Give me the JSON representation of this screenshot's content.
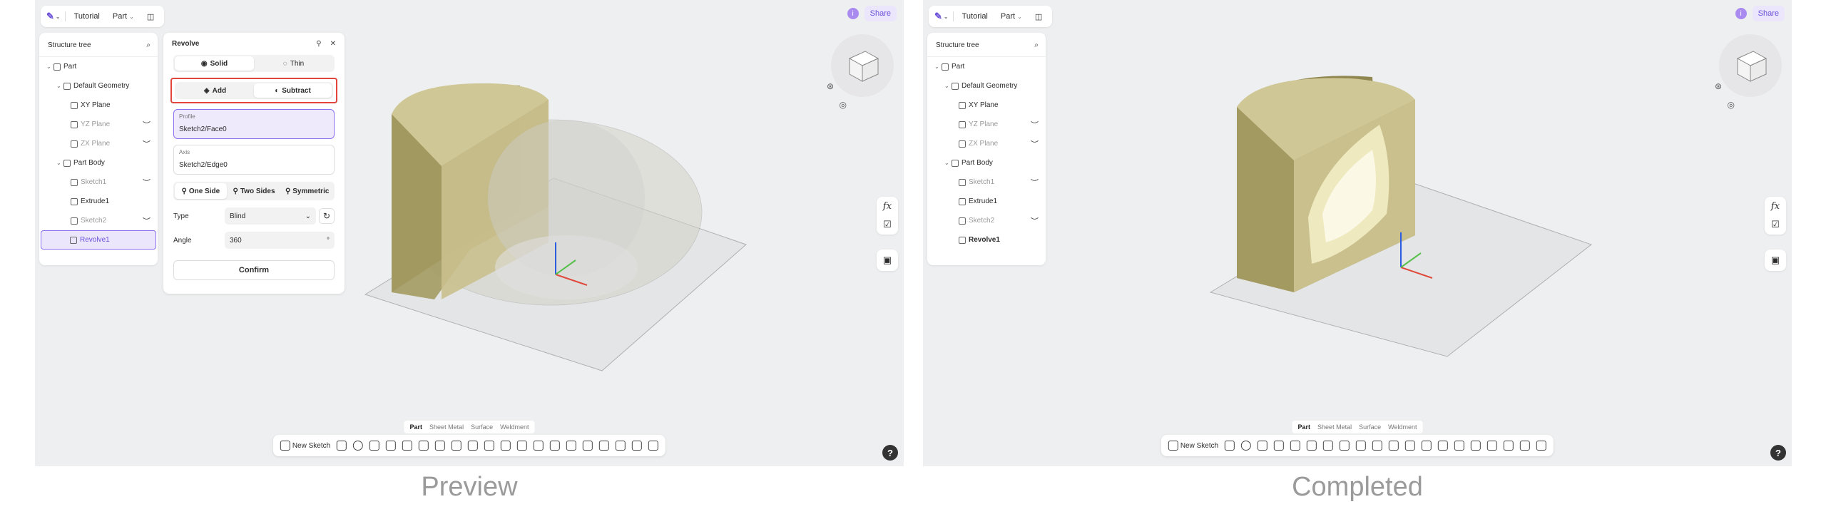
{
  "topbar": {
    "project": "Tutorial",
    "mode": "Part",
    "share": "Share",
    "avatar": "i"
  },
  "tree": {
    "title": "Structure tree",
    "items": [
      "Part",
      "Default Geometry",
      "XY Plane",
      "YZ Plane",
      "ZX Plane",
      "Part Body",
      "Sketch1",
      "Extrude1",
      "Sketch2",
      "Revolve1"
    ]
  },
  "revolve": {
    "title": "Revolve",
    "type_opts": [
      "Solid",
      "Thin"
    ],
    "bool_opts": [
      "Add",
      "Subtract"
    ],
    "profile_label": "Profile",
    "profile_value": "Sketch2/Face0",
    "axis_label": "Axis",
    "axis_value": "Sketch2/Edge0",
    "dir_opts": [
      "One Side",
      "Two Sides",
      "Symmetric"
    ],
    "type_label": "Type",
    "type_value": "Blind",
    "angle_label": "Angle",
    "angle_value": "360",
    "confirm": "Confirm"
  },
  "modes": [
    "Part",
    "Sheet Metal",
    "Surface",
    "Weldment"
  ],
  "toolbar": {
    "new_sketch": "New Sketch"
  },
  "help": "?",
  "fx": "fx",
  "captions": {
    "left": "Preview",
    "right": "Completed"
  },
  "colors": {
    "accent": "#6b4fd8",
    "highlight": "#e0463e",
    "solid": "#b9b07a"
  }
}
